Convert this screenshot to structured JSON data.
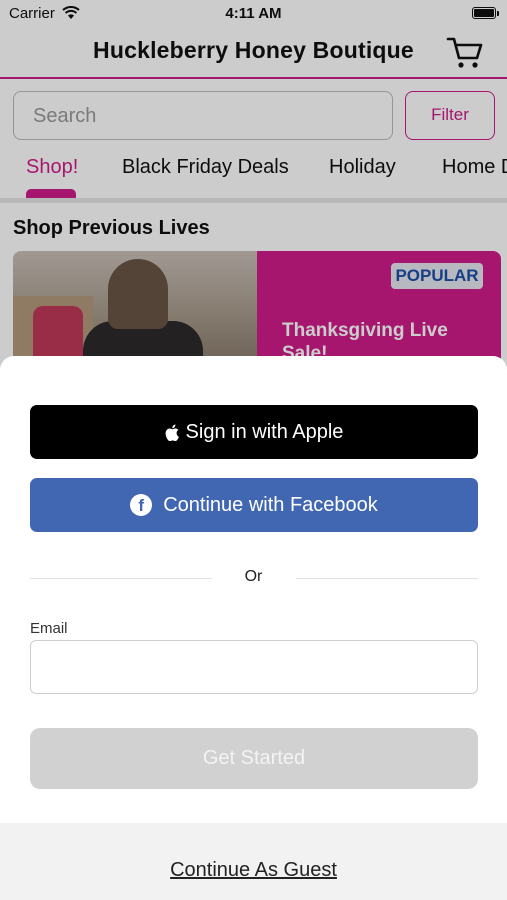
{
  "status_bar": {
    "carrier": "Carrier",
    "time": "4:11 AM"
  },
  "header": {
    "title": "Huckleberry Honey Boutique",
    "cart_icon": "cart-icon"
  },
  "search": {
    "placeholder": "Search",
    "filter_label": "Filter"
  },
  "tabs": [
    {
      "label": "Shop!",
      "active": true
    },
    {
      "label": "Black Friday Deals",
      "active": false
    },
    {
      "label": "Holiday",
      "active": false
    },
    {
      "label": "Home D",
      "active": false
    }
  ],
  "section": {
    "title": "Shop Previous Lives"
  },
  "live_card": {
    "badge": "POPULAR",
    "title": "Thanksgiving Live Sale!"
  },
  "sheet": {
    "apple_label": "Sign in with Apple",
    "facebook_label": "Continue with Facebook",
    "or_label": "Or",
    "email_label": "Email",
    "email_value": "",
    "get_started_label": "Get Started",
    "guest_label": "Continue As Guest"
  },
  "colors": {
    "accent": "#d01c8b",
    "facebook": "#4267b2",
    "badge_text": "#1d4fa8"
  }
}
